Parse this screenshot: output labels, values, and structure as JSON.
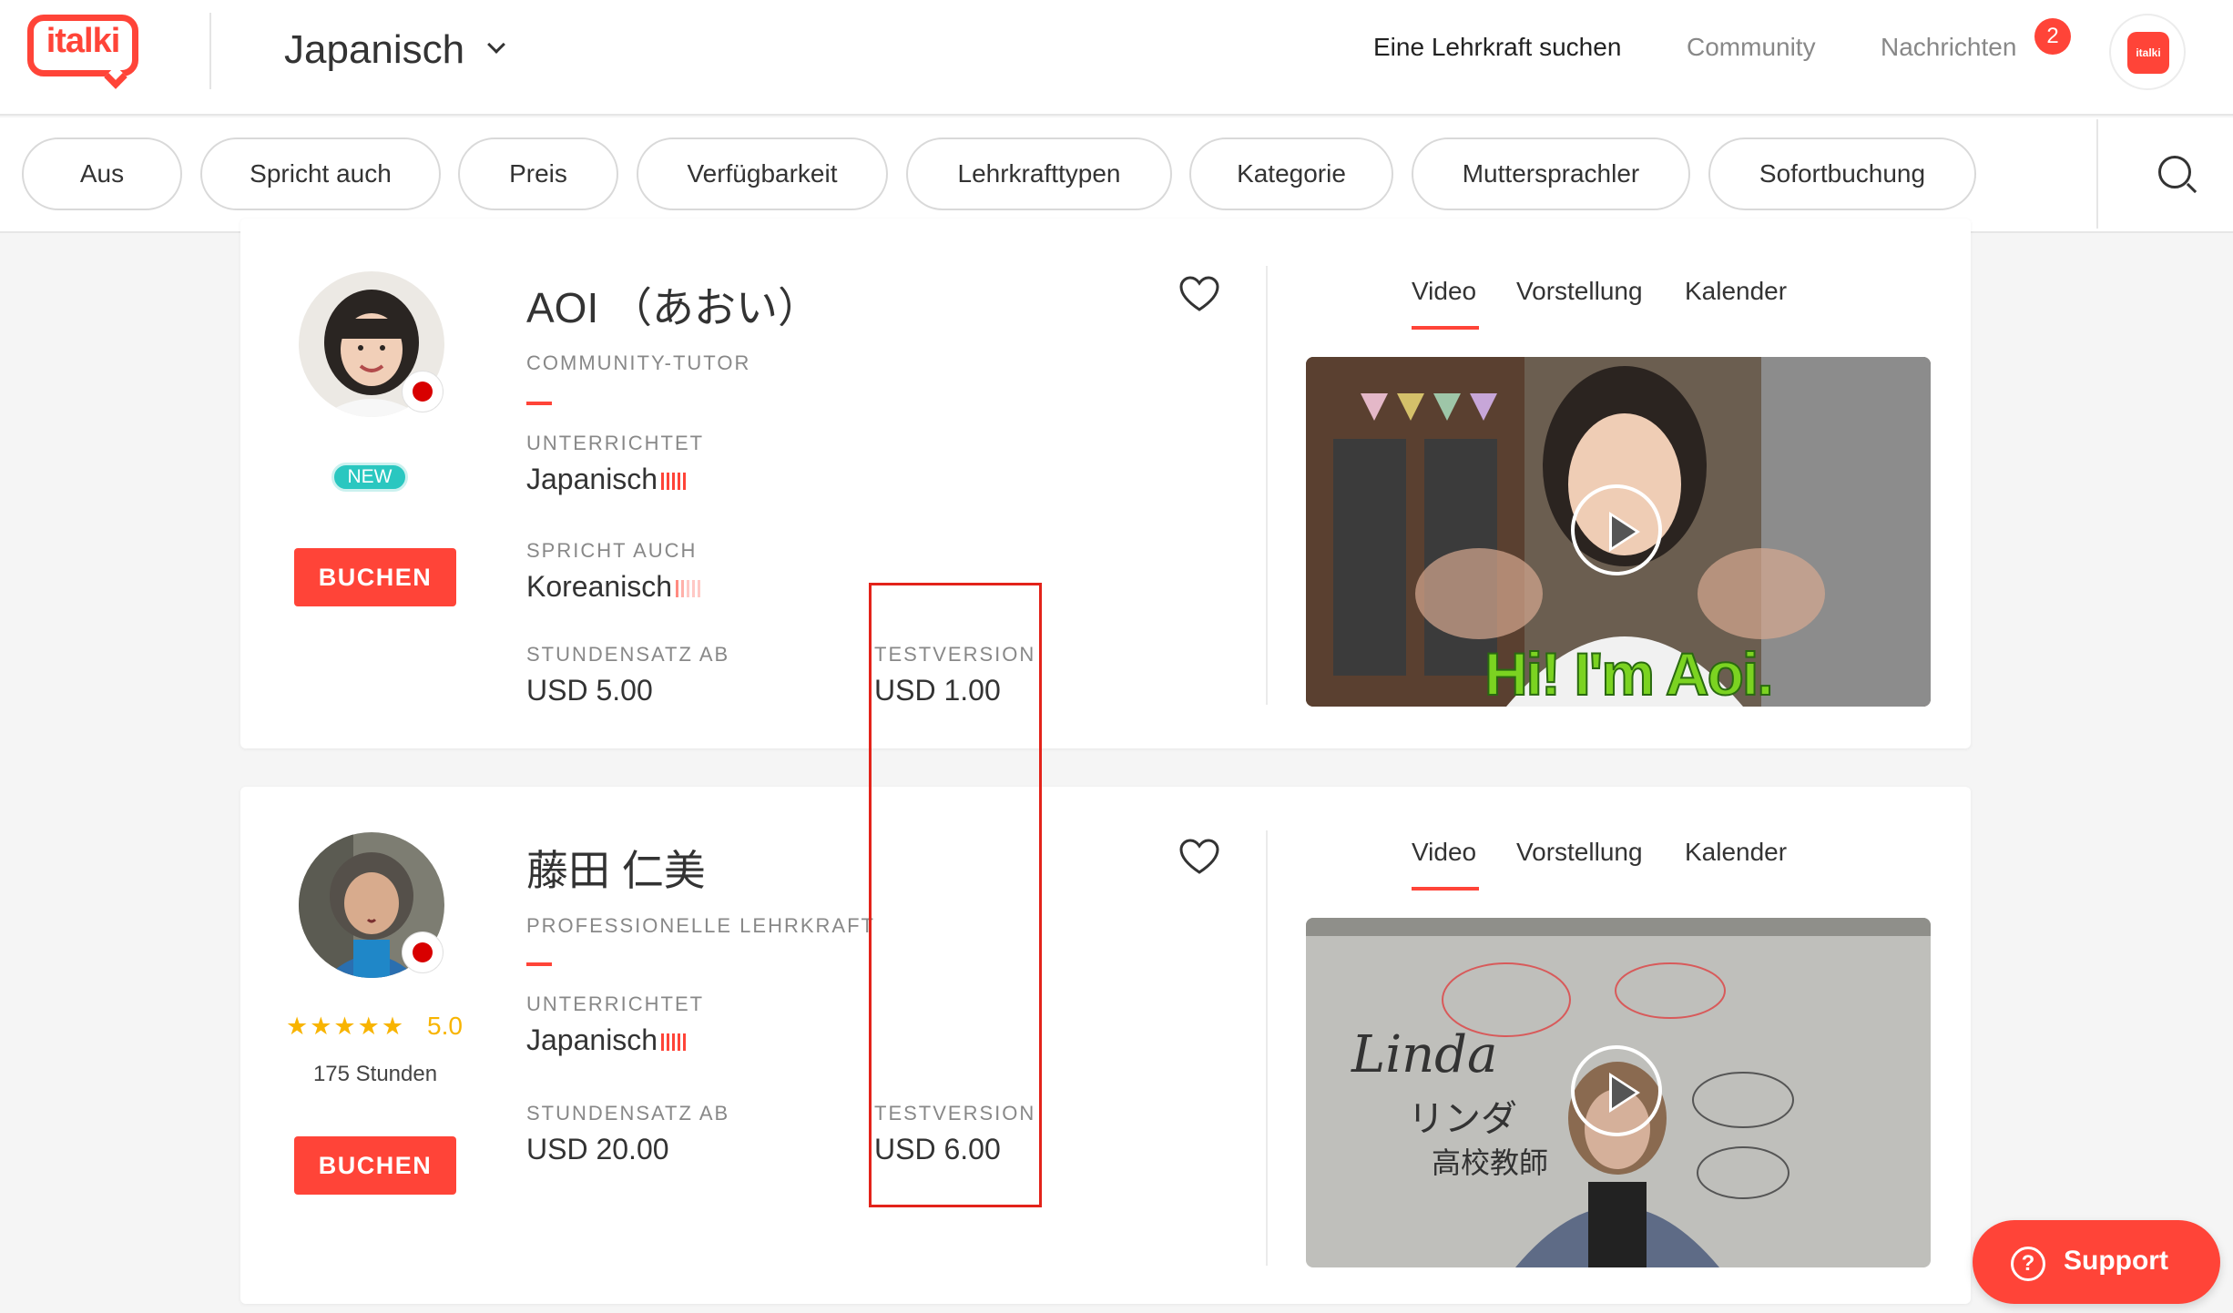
{
  "header": {
    "logo_text": "italki",
    "language": "Japanisch",
    "nav": {
      "find_teacher": "Eine Lehrkraft suchen",
      "community": "Community",
      "messages": "Nachrichten",
      "messages_count": "2"
    },
    "avatar_text": "italki"
  },
  "filters": [
    "Aus",
    "Spricht auch",
    "Preis",
    "Verfügbarkeit",
    "Lehrkrafttypen",
    "Kategorie",
    "Muttersprachler",
    "Sofortbuchung"
  ],
  "tutors": [
    {
      "name": "AOI （あおい）",
      "type": "COMMUNITY-TUTOR",
      "badge": "NEW",
      "book_label": "BUCHEN",
      "teaches_label": "UNTERRICHTET",
      "teaches": "Japanisch",
      "speaks_label": "SPRICHT AUCH",
      "speaks": "Koreanisch",
      "rate_label": "STUNDENSATZ AB",
      "rate": "USD 5.00",
      "trial_label": "TESTVERSION",
      "trial": "USD 1.00",
      "tabs": [
        "Video",
        "Vorstellung",
        "Kalender"
      ],
      "video_caption": "Hi! I'm Aoi."
    },
    {
      "name": "藤田 仁美",
      "type": "PROFESSIONELLE LEHRKRAFT",
      "stars": "★★★★★",
      "rating": "5.0",
      "hours": "175 Stunden",
      "book_label": "BUCHEN",
      "teaches_label": "UNTERRICHTET",
      "teaches": "Japanisch",
      "rate_label": "STUNDENSATZ AB",
      "rate": "USD 20.00",
      "trial_label": "TESTVERSION",
      "trial": "USD 6.00",
      "tabs": [
        "Video",
        "Vorstellung",
        "Kalender"
      ],
      "whiteboard": [
        "Linda",
        "リンダ",
        "高校教師"
      ]
    }
  ],
  "support_label": "Support",
  "colors": {
    "accent": "#ff4438",
    "new_badge": "#2ac7c0",
    "star": "#f8b400",
    "highlight": "#e3231a"
  }
}
